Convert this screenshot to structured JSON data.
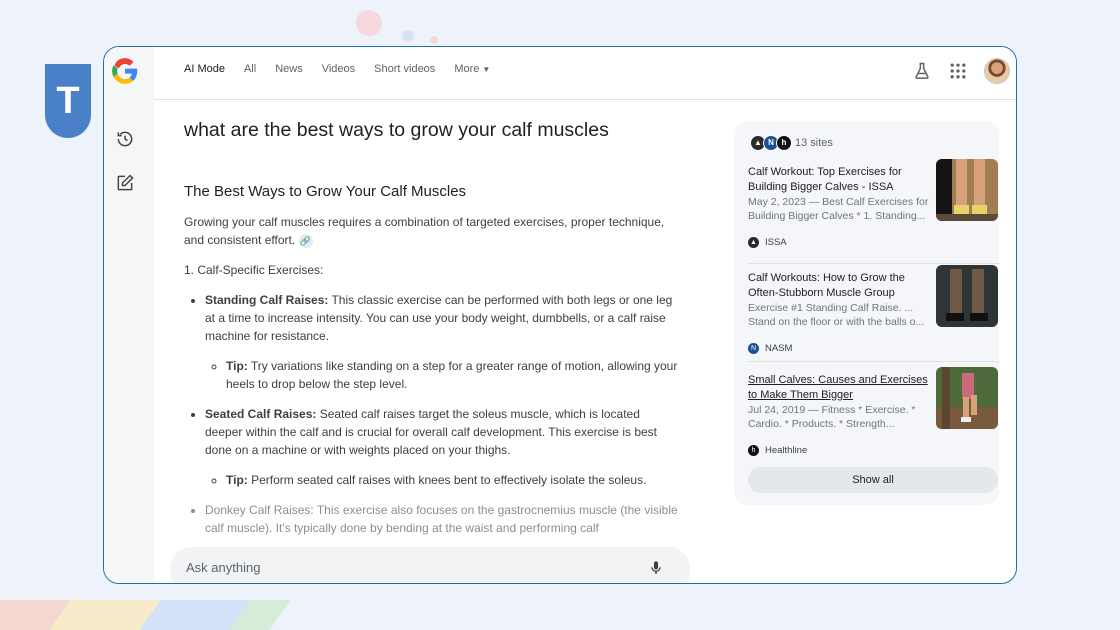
{
  "brand_badge": {
    "letter": "T"
  },
  "nav": {
    "tabs": [
      {
        "label": "AI Mode",
        "active": true
      },
      {
        "label": "All"
      },
      {
        "label": "News"
      },
      {
        "label": "Videos"
      },
      {
        "label": "Short videos"
      },
      {
        "label": "More"
      }
    ]
  },
  "query": "what are the best ways to grow your calf muscles",
  "answer": {
    "heading": "The Best Ways to Grow Your Calf Muscles",
    "intro": "Growing your calf muscles requires a combination of targeted exercises, proper technique, and consistent effort.",
    "section1": "1. Calf-Specific Exercises:",
    "items": [
      {
        "title": "Standing Calf Raises:",
        "text": " This classic exercise can be performed with both legs or one leg at a time to increase intensity. You can use your body weight, dumbbells, or a calf raise machine for resistance.",
        "tip_label": "Tip:",
        "tip": " Try variations like standing on a step for a greater range of motion, allowing your heels to drop below the step level."
      },
      {
        "title": "Seated Calf Raises:",
        "text": " Seated calf raises target the soleus muscle, which is located deeper within the calf and is crucial for overall calf development. This exercise is best done on a machine or with weights placed on your thighs.",
        "tip_label": "Tip:",
        "tip": " Perform seated calf raises with knees bent to effectively isolate the soleus."
      },
      {
        "title": "Donkey Calf Raises:",
        "text": " This exercise also focuses on the gastrocnemius muscle (the visible calf muscle). It's typically done by bending at the waist and performing calf"
      }
    ]
  },
  "ask": {
    "placeholder": "Ask anything"
  },
  "sources": {
    "count_label": "13 sites",
    "cards": [
      {
        "title": "Calf Workout: Top Exercises for Building Bigger Calves - ISSA",
        "snippet": "May 2, 2023 — Best Calf Exercises for Building Bigger Calves * 1. Standing...",
        "site": "ISSA"
      },
      {
        "title": "Calf Workouts: How to Grow the Often-Stubborn Muscle Group",
        "snippet": "Exercise #1 Standing Calf Raise. ... Stand on the floor or with the balls o...",
        "site": "NASM"
      },
      {
        "title": "Small Calves: Causes and Exercises to Make Them Bigger",
        "snippet": "Jul 24, 2019 — Fitness * Exercise. * Cardio. * Products. * Strength...",
        "site": "Healthline"
      }
    ],
    "show_all": "Show all"
  },
  "colors": {
    "frame_border": "#1f6fa8",
    "badge": "#4a80c8",
    "page_bg": "#eef3fb"
  }
}
